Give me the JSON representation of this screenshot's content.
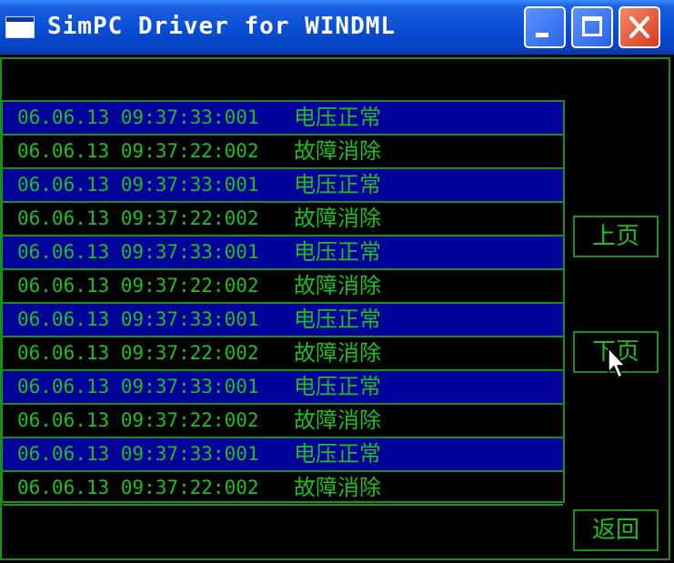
{
  "window": {
    "title": "SimPC Driver for WINDML"
  },
  "titlebar_buttons": {
    "minimize_icon": "minimize-icon",
    "maximize_icon": "maximize-icon",
    "close_icon": "close-icon"
  },
  "log": {
    "rows": [
      {
        "timestamp": "06.06.13 09:37:33:001",
        "message": "电压正常",
        "selected": true
      },
      {
        "timestamp": "06.06.13 09:37:22:002",
        "message": "故障消除",
        "selected": false
      },
      {
        "timestamp": "06.06.13 09:37:33:001",
        "message": "电压正常",
        "selected": true
      },
      {
        "timestamp": "06.06.13 09:37:22:002",
        "message": "故障消除",
        "selected": false
      },
      {
        "timestamp": "06.06.13 09:37:33:001",
        "message": "电压正常",
        "selected": true
      },
      {
        "timestamp": "06.06.13 09:37:22:002",
        "message": "故障消除",
        "selected": false
      },
      {
        "timestamp": "06.06.13 09:37:33:001",
        "message": "电压正常",
        "selected": true
      },
      {
        "timestamp": "06.06.13 09:37:22:002",
        "message": "故障消除",
        "selected": false
      },
      {
        "timestamp": "06.06.13 09:37:33:001",
        "message": "电压正常",
        "selected": true
      },
      {
        "timestamp": "06.06.13 09:37:22:002",
        "message": "故障消除",
        "selected": false
      },
      {
        "timestamp": "06.06.13 09:37:33:001",
        "message": "电压正常",
        "selected": true
      },
      {
        "timestamp": "06.06.13 09:37:22:002",
        "message": "故障消除",
        "selected": false
      }
    ]
  },
  "buttons": {
    "prev_page": "上页",
    "next_page": "下页",
    "back": "返回"
  },
  "colors": {
    "text": "#1fbf1f",
    "border": "#1a8f1a",
    "selected_row": "#00009a",
    "background": "#000000"
  }
}
